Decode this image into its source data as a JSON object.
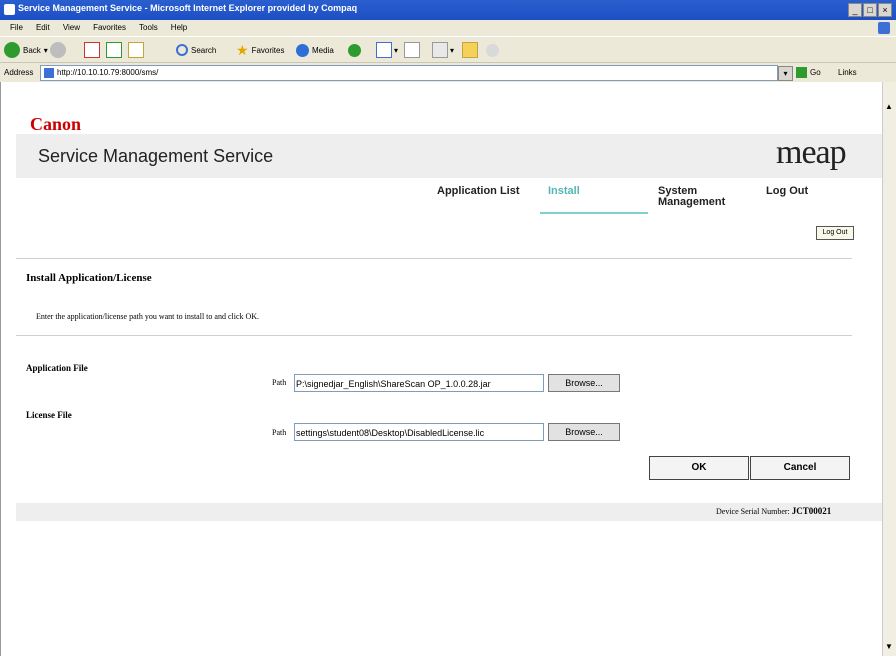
{
  "window": {
    "title": "Service Management Service - Microsoft Internet Explorer provided by Compaq",
    "controls": [
      "_",
      "□",
      "×"
    ]
  },
  "menu": [
    "File",
    "Edit",
    "View",
    "Favorites",
    "Tools",
    "Help"
  ],
  "toolbar": {
    "back": "Back",
    "search": "Search",
    "favorites": "Favorites",
    "media": "Media"
  },
  "address": {
    "label": "Address",
    "url": "http://10.10.10.79:8000/sms/",
    "go": "Go",
    "links": "Links"
  },
  "page": {
    "brand": "Canon",
    "service_title": "Service Management Service",
    "logo": "meap",
    "nav": {
      "application_list": "Application List",
      "install": "Install",
      "system_management_1": "System",
      "system_management_2": "Management",
      "log_out": "Log Out"
    },
    "logout_button": "Log Out",
    "section_title": "Install Application/License",
    "instruction": "Enter the application/license path you want to install to and click OK.",
    "application_file": {
      "label": "Application File",
      "path_label": "Path",
      "value": "P:\\signedjar_English\\ShareScan OP_1.0.0.28.jar",
      "browse": "Browse..."
    },
    "license_file": {
      "label": "License File",
      "path_label": "Path",
      "value": "settings\\student08\\Desktop\\DisabledLicense.lic",
      "browse": "Browse..."
    },
    "ok": "OK",
    "cancel": "Cancel",
    "serial_label": "Device Serial Number:",
    "serial_value": "JCT00021"
  },
  "colors": {
    "titlebar": "#1d4fc4",
    "brand_red": "#cc0000",
    "active_tab": "#55b5b5"
  }
}
